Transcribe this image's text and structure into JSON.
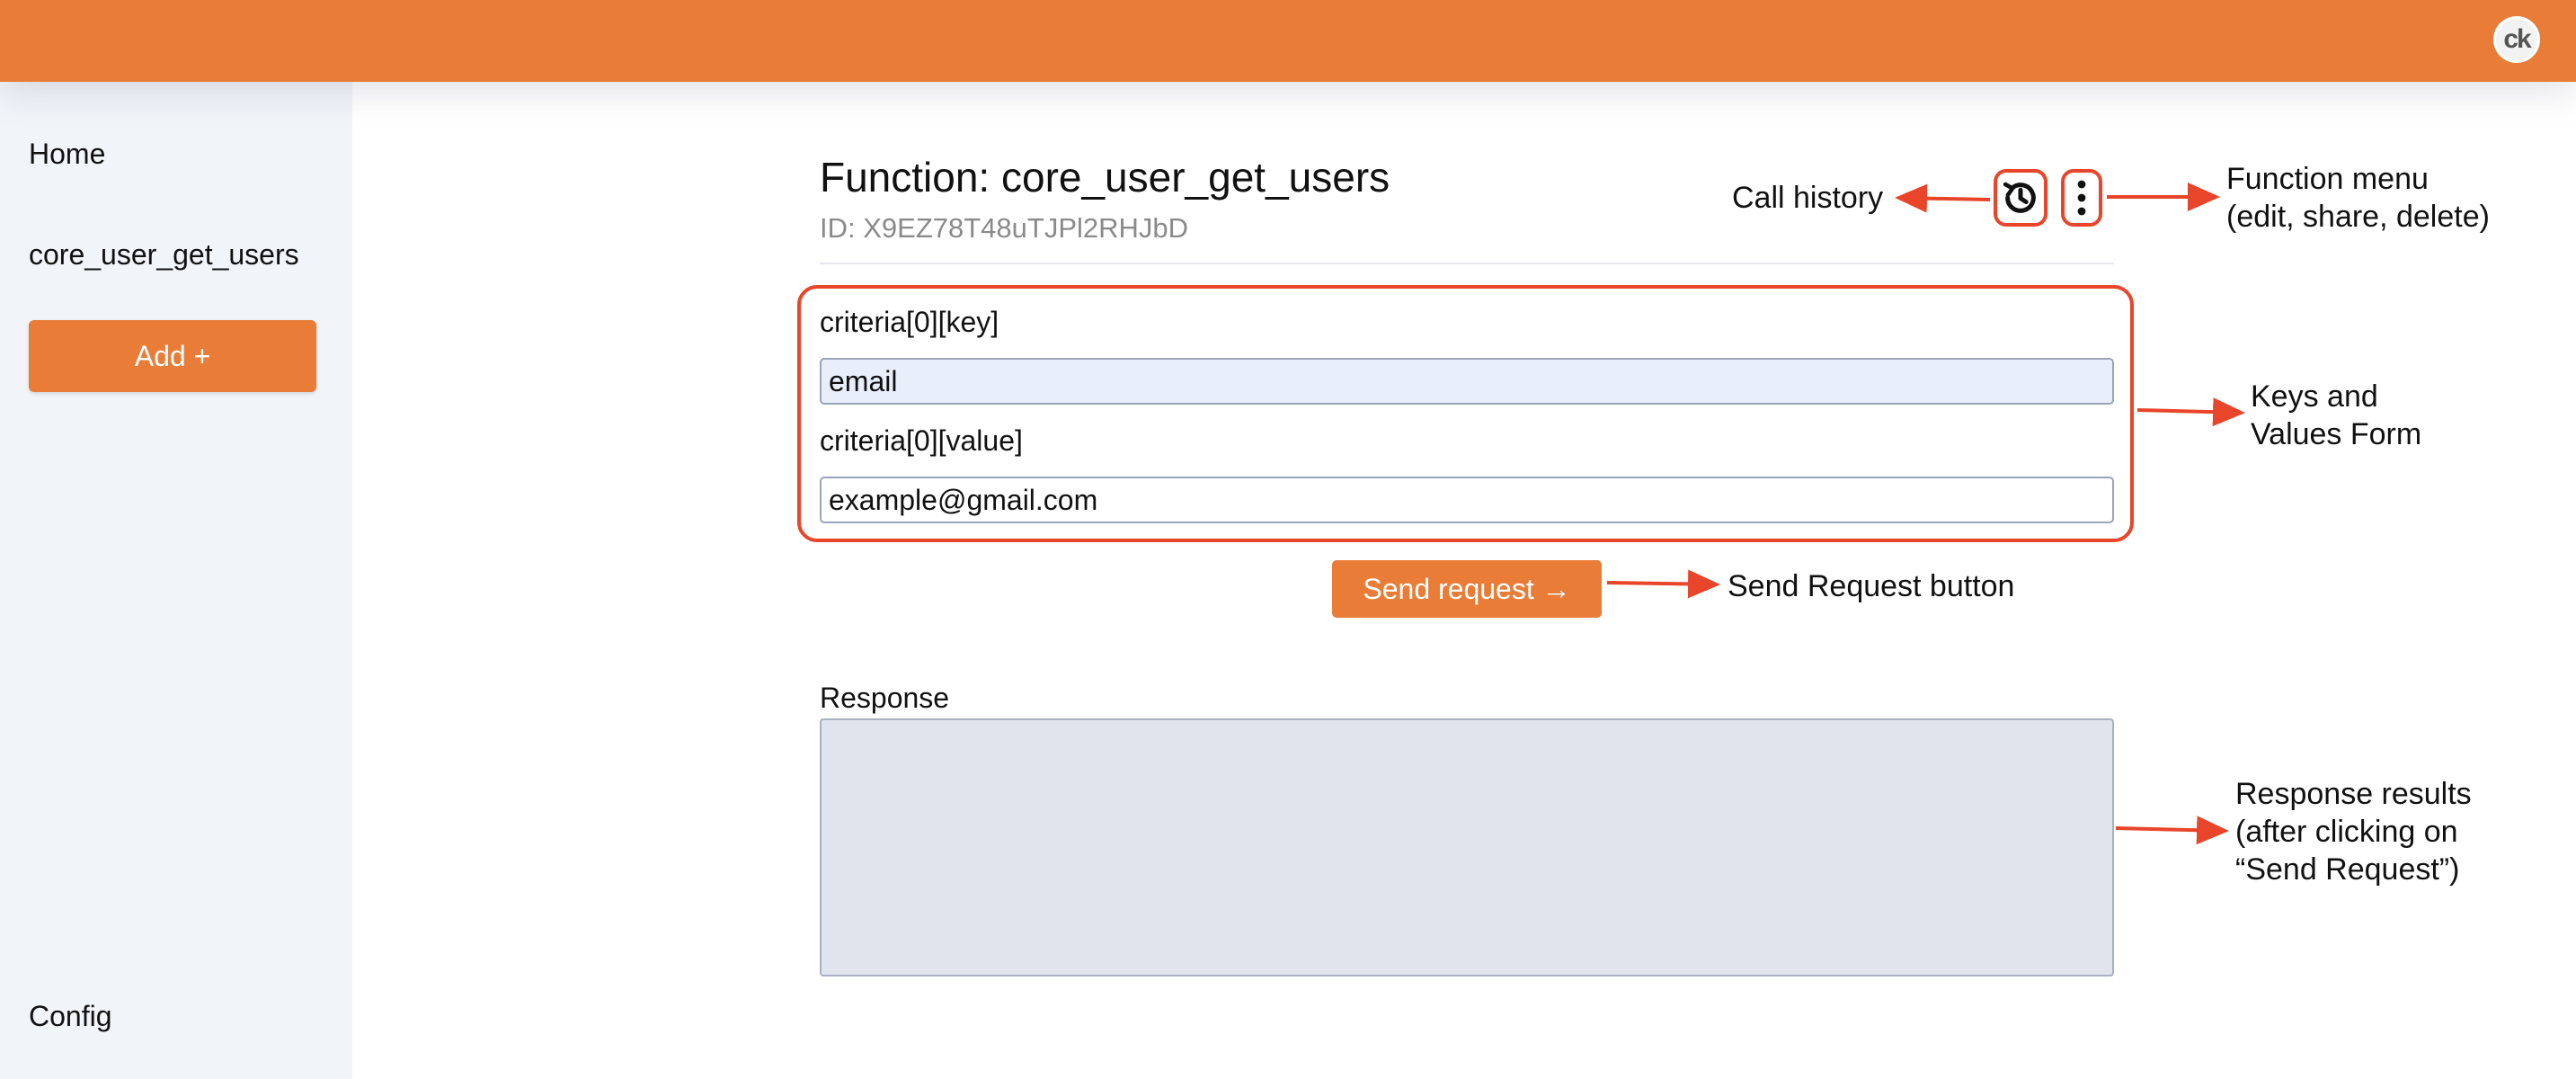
{
  "header": {
    "avatar_text": "ck",
    "accent": "#e97d38"
  },
  "sidebar": {
    "items": [
      {
        "label": "Home"
      },
      {
        "label": "core_user_get_users"
      }
    ],
    "add_label": "Add +",
    "config_label": "Config"
  },
  "function": {
    "title": "Function: core_user_get_users",
    "id_text": "ID: X9EZ78T48uTJPl2RHJbD",
    "history_icon": "history-icon",
    "menu_icon": "more-vertical-icon"
  },
  "form": {
    "fields": [
      {
        "label": "criteria[0][key]",
        "value": "email"
      },
      {
        "label": "criteria[0][value]",
        "value": "example@gmail.com"
      }
    ],
    "send_label": "Send request →"
  },
  "response": {
    "label": "Response",
    "value": ""
  },
  "annotations": {
    "call_history": "Call history",
    "function_menu": [
      "Function menu",
      "(edit, share, delete)"
    ],
    "keys_values": [
      "Keys and",
      "Values Form"
    ],
    "send_request": "Send Request button",
    "response_results": [
      "Response results",
      "(after clicking on",
      "“Send Request”)"
    ],
    "annotation_color": "#e8452a"
  }
}
